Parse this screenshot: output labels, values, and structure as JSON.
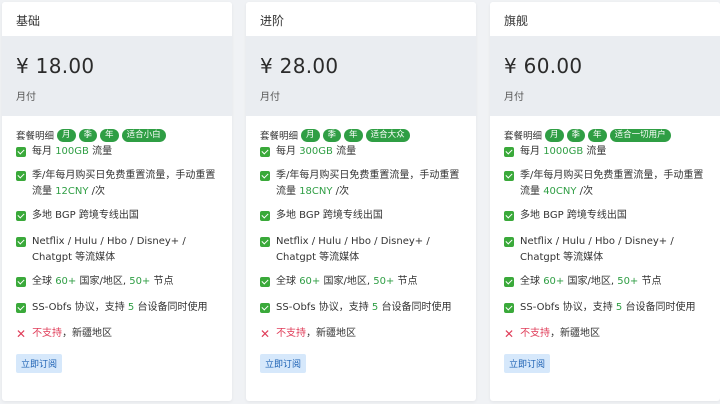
{
  "plans": [
    {
      "name": "基础",
      "price": "¥ 18.00",
      "period": "月付",
      "detail_label": "套餐明细",
      "tags": [
        "月",
        "季",
        "年",
        "适合小白"
      ],
      "features": {
        "traffic": {
          "pre": "每月 ",
          "hl": "100GB",
          "post": " 流量"
        },
        "reset": {
          "pre": "季/年每月购买日免费重置流量，手动重置流量 ",
          "hl": "12CNY",
          "post": " /次"
        },
        "bgp": "多地 BGP 跨境专线出国",
        "media": "Netflix / Hulu / Hbo / Disney+ / Chatgpt 等流媒体",
        "nodes": {
          "a": "全球 ",
          "b": "60+",
          "c": " 国家/地区, ",
          "d": "50+",
          "e": " 节点"
        },
        "protocol": {
          "a": "SS-Obfs 协议，支持 ",
          "b": "5",
          "c": " 台设备同时使用"
        },
        "unsupported": {
          "a": "不支持",
          "b": "，新疆地区"
        }
      },
      "button": "立即订阅"
    },
    {
      "name": "进阶",
      "price": "¥ 28.00",
      "period": "月付",
      "detail_label": "套餐明细",
      "tags": [
        "月",
        "季",
        "年",
        "适合大众"
      ],
      "features": {
        "traffic": {
          "pre": "每月 ",
          "hl": "300GB",
          "post": " 流量"
        },
        "reset": {
          "pre": "季/年每月购买日免费重置流量，手动重置流量 ",
          "hl": "18CNY",
          "post": " /次"
        },
        "bgp": "多地 BGP 跨境专线出国",
        "media": "Netflix / Hulu / Hbo / Disney+ / Chatgpt 等流媒体",
        "nodes": {
          "a": "全球 ",
          "b": "60+",
          "c": " 国家/地区, ",
          "d": "50+",
          "e": " 节点"
        },
        "protocol": {
          "a": "SS-Obfs 协议，支持 ",
          "b": "5",
          "c": " 台设备同时使用"
        },
        "unsupported": {
          "a": "不支持",
          "b": "，新疆地区"
        }
      },
      "button": "立即订阅"
    },
    {
      "name": "旗舰",
      "price": "¥ 60.00",
      "period": "月付",
      "detail_label": "套餐明细",
      "tags": [
        "月",
        "季",
        "年",
        "适合一切用户"
      ],
      "features": {
        "traffic": {
          "pre": "每月 ",
          "hl": "1000GB",
          "post": " 流量"
        },
        "reset": {
          "pre": "季/年每月购买日免费重置流量，手动重置流量 ",
          "hl": "40CNY",
          "post": " /次"
        },
        "bgp": "多地 BGP 跨境专线出国",
        "media": "Netflix / Hulu / Hbo / Disney+ / Chatgpt 等流媒体",
        "nodes": {
          "a": "全球 ",
          "b": "60+",
          "c": " 国家/地区, ",
          "d": "50+",
          "e": " 节点"
        },
        "protocol": {
          "a": "SS-Obfs 协议，支持 ",
          "b": "5",
          "c": " 台设备同时使用"
        },
        "unsupported": {
          "a": "不支持",
          "b": "，新疆地区"
        }
      },
      "button": "立即订阅"
    }
  ],
  "colors": {
    "accent_green": "#2f9e44",
    "cross_red": "#e03e5a",
    "button_bg": "#d6e8fb",
    "button_text": "#1f63b5",
    "price_bg": "#eaedf1"
  },
  "icons": {
    "check": "check-box-icon",
    "cross": "cross-icon"
  }
}
